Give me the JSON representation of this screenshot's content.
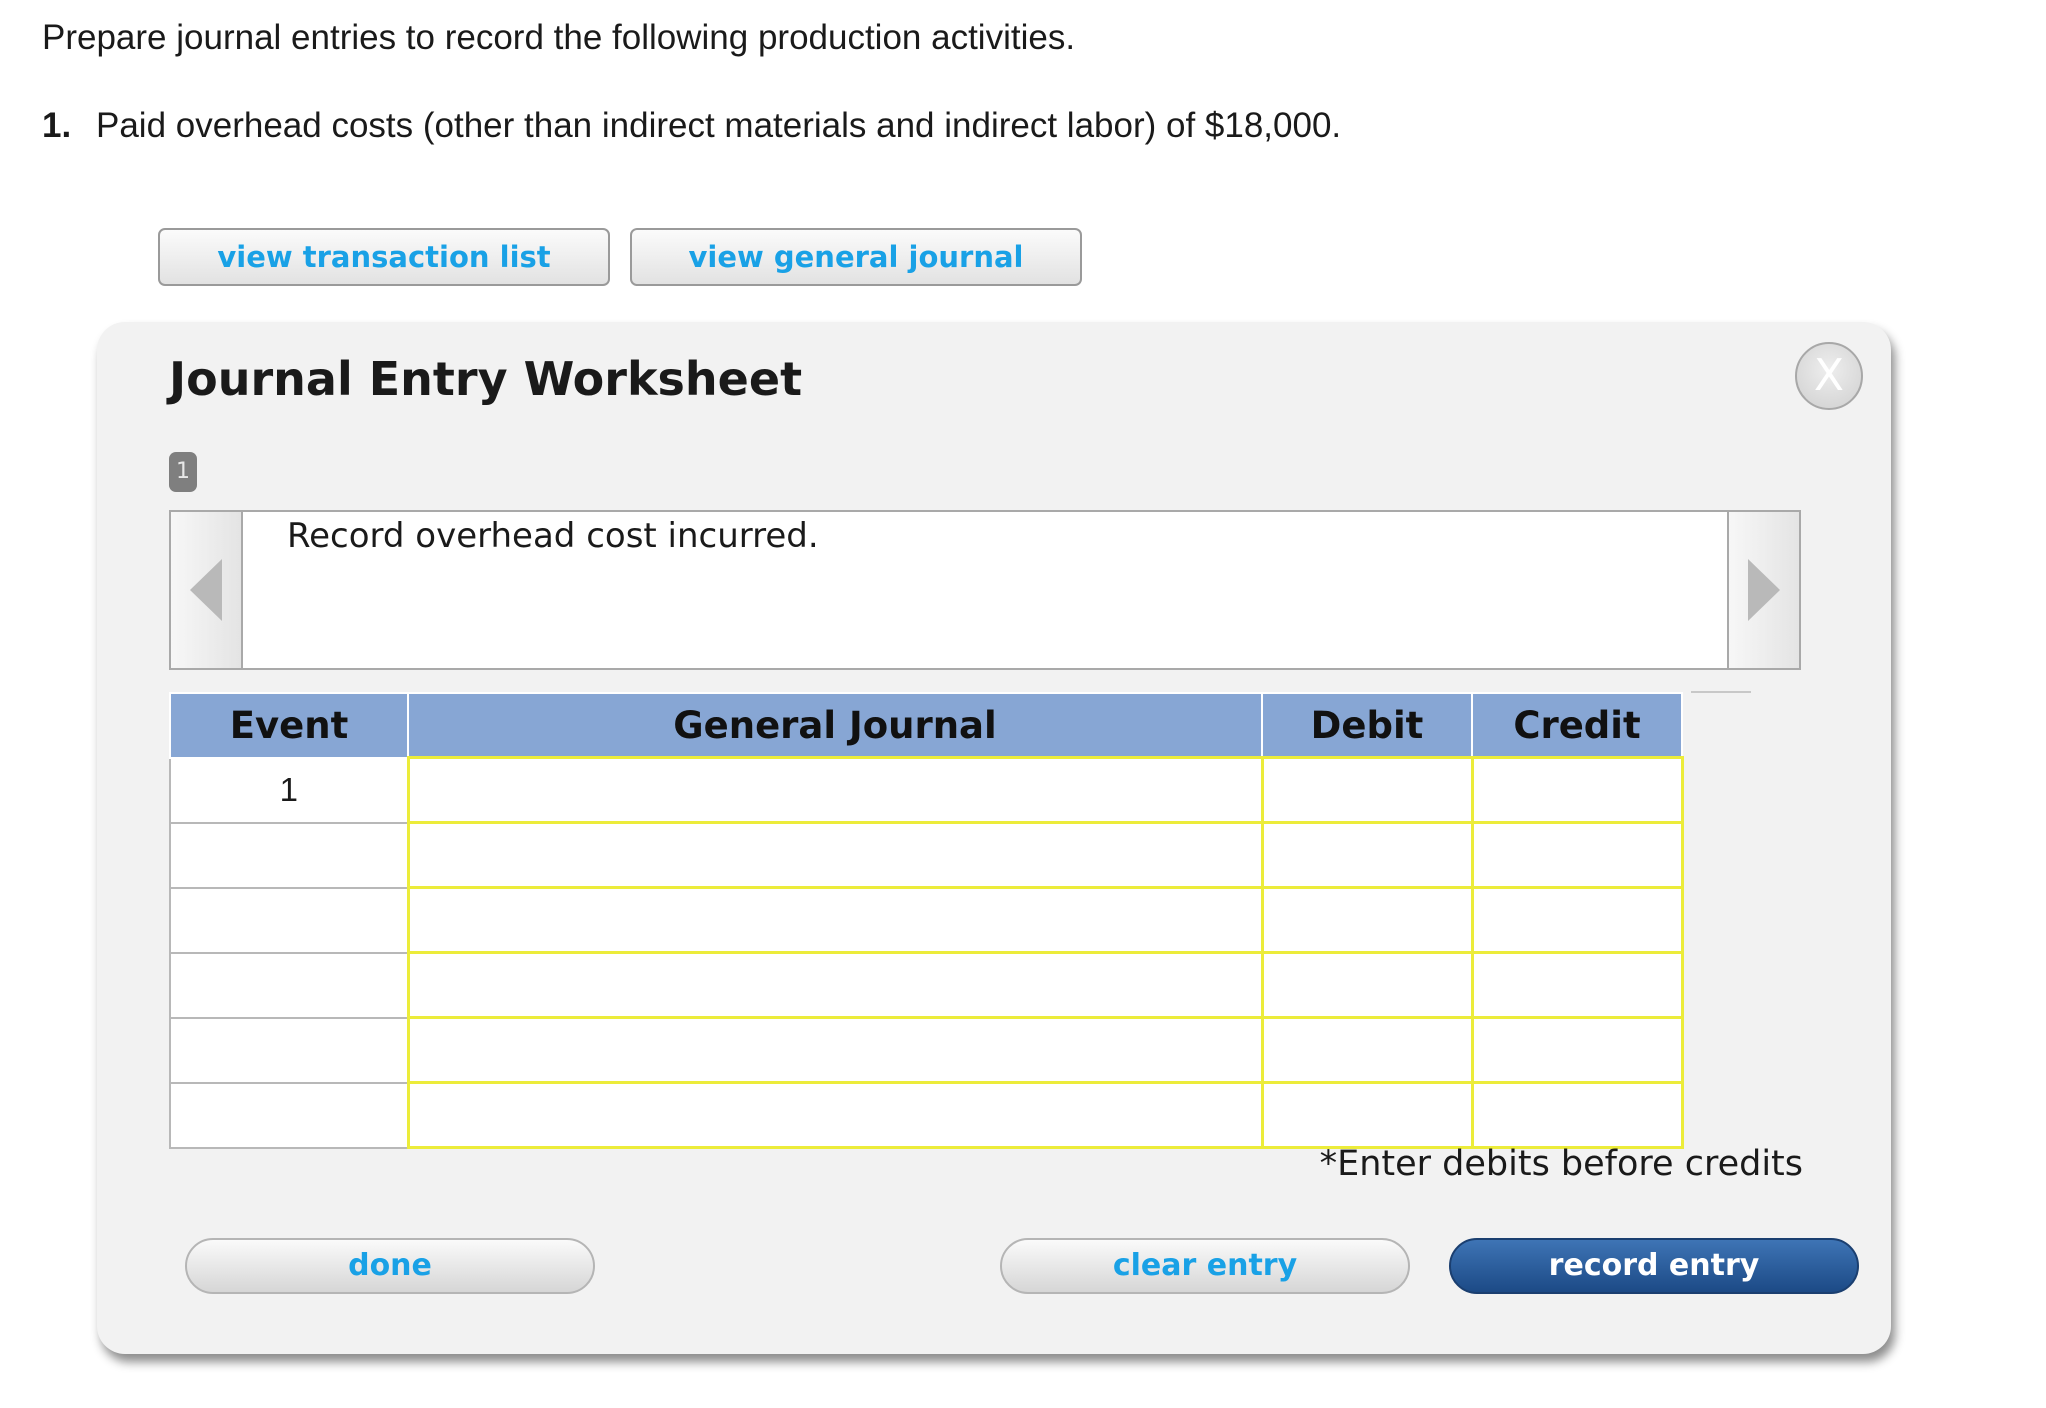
{
  "intro": "Prepare journal entries to record the following production activities.",
  "question": {
    "number": "1.",
    "text": "Paid overhead costs (other than indirect materials and indirect labor) of $18,000."
  },
  "top_buttons": {
    "transaction_list": "view transaction list",
    "general_journal": "view general journal"
  },
  "worksheet": {
    "title": "Journal Entry Worksheet",
    "close_label": "X",
    "page_badge": "1",
    "description": "Record overhead cost incurred.",
    "columns": [
      "Event",
      "General Journal",
      "Debit",
      "Credit"
    ],
    "rows": [
      {
        "event": "1",
        "account": "",
        "debit": "",
        "credit": ""
      },
      {
        "event": "",
        "account": "",
        "debit": "",
        "credit": ""
      },
      {
        "event": "",
        "account": "",
        "debit": "",
        "credit": ""
      },
      {
        "event": "",
        "account": "",
        "debit": "",
        "credit": ""
      },
      {
        "event": "",
        "account": "",
        "debit": "",
        "credit": ""
      },
      {
        "event": "",
        "account": "",
        "debit": "",
        "credit": ""
      }
    ],
    "note": "*Enter debits before credits",
    "buttons": {
      "done": "done",
      "clear": "clear entry",
      "record": "record entry"
    }
  },
  "colors": {
    "link_blue": "#19a1e6",
    "header_blue": "#87a6d4",
    "input_border_yellow": "#ecec3a",
    "primary_button": "#2a5d9e"
  }
}
